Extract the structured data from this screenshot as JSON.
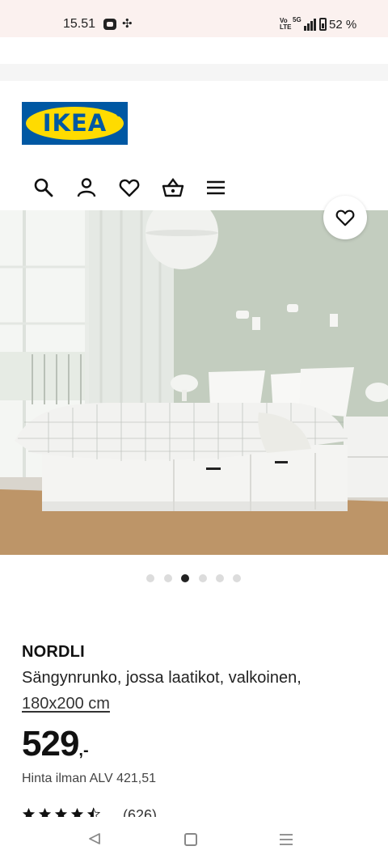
{
  "status_bar": {
    "time": "15.51",
    "network": "Vo LTE",
    "signal": "5G",
    "battery": "52 %"
  },
  "header": {
    "logo_text": "IKEA",
    "icons": [
      "search-icon",
      "account-icon",
      "heart-icon",
      "basket-icon",
      "menu-icon"
    ]
  },
  "gallery": {
    "image_count": 6,
    "active_index": 2
  },
  "product": {
    "name": "NORDLI",
    "description": "Sängynrunko, jossa laatikot, valkoinen,",
    "size": "180x200 cm",
    "price": "529",
    "price_suffix": ",-",
    "price_vat": "Hinta ilman ALV 421,51",
    "rating_value": 4.5,
    "rating_count": "(626)"
  },
  "colors": {
    "ikea_blue": "#0058a3",
    "ikea_yellow": "#ffdb00",
    "status_bg": "#fbf1ef"
  }
}
